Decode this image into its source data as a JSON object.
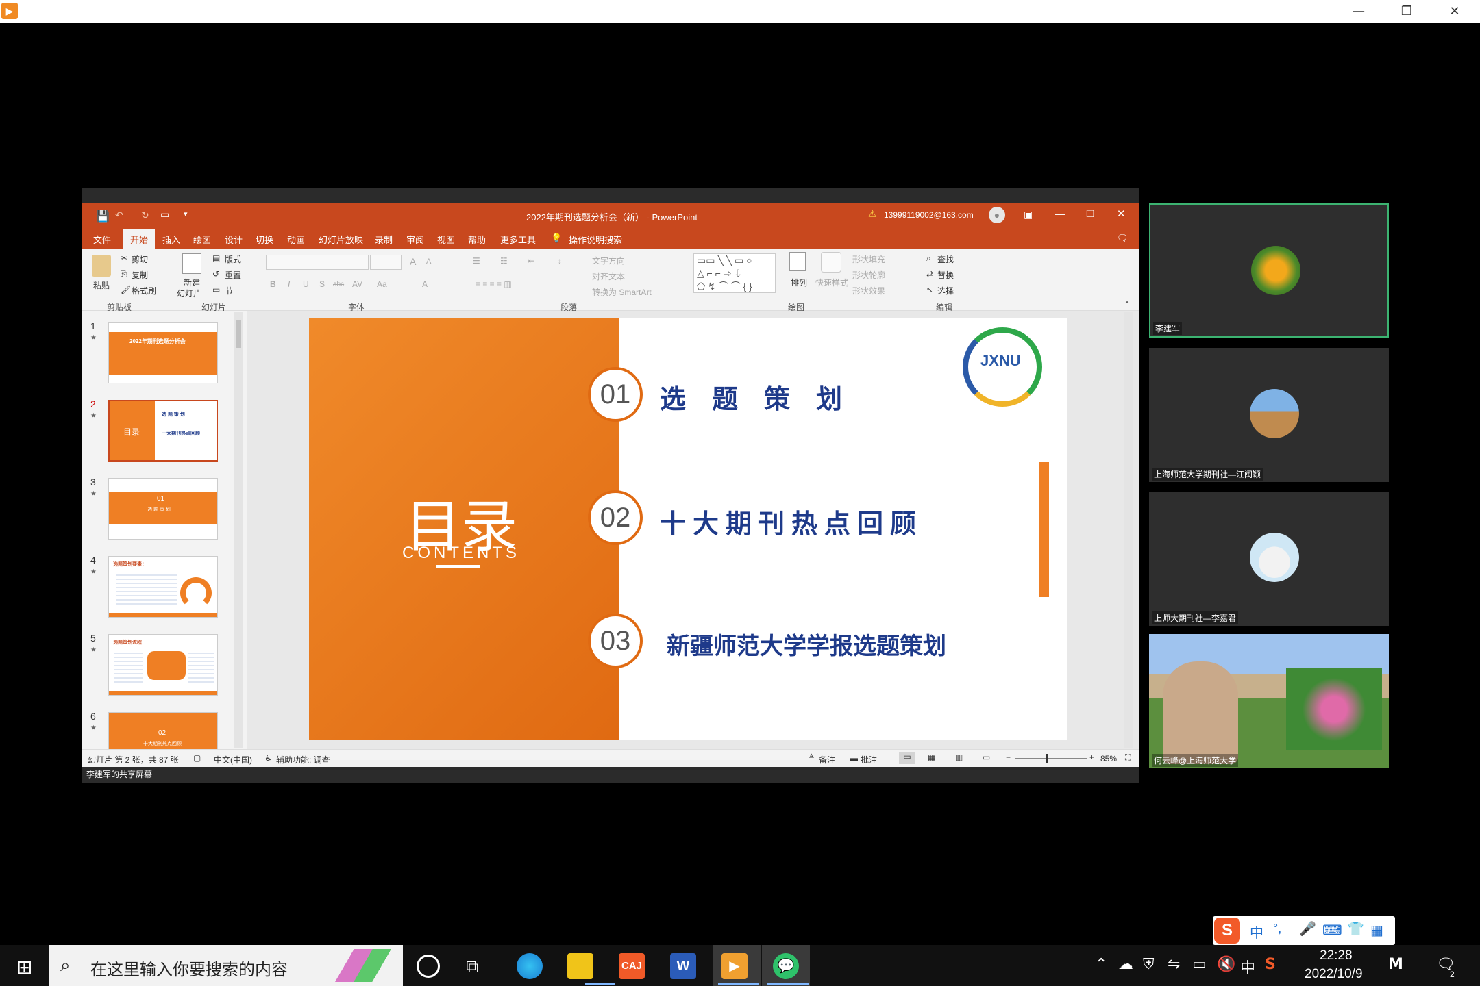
{
  "os_window": {
    "min": "—",
    "restore": "❐",
    "close": "✕"
  },
  "ppt": {
    "title": "2022年期刊选题分析会（新） - PowerPoint",
    "account": "13999119002@163.com",
    "tabs": [
      "文件",
      "开始",
      "插入",
      "绘图",
      "设计",
      "切换",
      "动画",
      "幻灯片放映",
      "录制",
      "审阅",
      "视图",
      "帮助",
      "更多工具",
      "操作说明搜索"
    ],
    "ribbon": {
      "paste": "粘贴",
      "cut": "剪切",
      "copy": "复制",
      "format_painter": "格式刷",
      "clipboard": "剪贴板",
      "new_slide_1": "新建",
      "new_slide_2": "幻灯片",
      "layout": "版式",
      "reset": "重置",
      "section": "节",
      "slides": "幻灯片",
      "font": "字体",
      "text_direction": "文字方向",
      "align_text": "对齐文本",
      "smartart": "转换为 SmartArt",
      "paragraph": "段落",
      "arrange": "排列",
      "quick_styles": "快速样式",
      "shape_fill": "形状填充",
      "shape_outline": "形状轮廓",
      "shape_effects": "形状效果",
      "drawing": "绘图",
      "find": "查找",
      "replace": "替换",
      "select": "选择",
      "editing": "编辑",
      "font_b": "B",
      "font_i": "I",
      "font_u": "U",
      "font_s": "S",
      "font_abc": "abc",
      "font_av": "AV",
      "font_aa": "Aa",
      "font_a": "A",
      "grow": "A",
      "shrink": "A"
    },
    "thumbnails": [
      {
        "num": "1",
        "title": "2022年期刊选题分析会",
        "t2": "",
        "t3": ""
      },
      {
        "num": "2",
        "title": "目录",
        "t2": "选 题 策 划",
        "t3": "十大期刊热点回顾"
      },
      {
        "num": "3",
        "title": "01",
        "t2": "选 题 策 划",
        "t3": ""
      },
      {
        "num": "4",
        "title": "选题策划要素：",
        "t2": "",
        "t3": ""
      },
      {
        "num": "5",
        "title": "选题策划流程",
        "t2": "",
        "t3": ""
      },
      {
        "num": "6",
        "title": "02",
        "t2": "十大期刊热点回顾",
        "t3": ""
      }
    ],
    "slide": {
      "title": "目录",
      "subtitle": "CONTENTS",
      "items": [
        {
          "num": "01",
          "text": "选　题　策　划"
        },
        {
          "num": "02",
          "text": "十大期刊热点回顾"
        },
        {
          "num": "03",
          "text": "新疆师范大学学报选题策划"
        }
      ],
      "logo_text": "JXNU"
    },
    "status": {
      "slide_info": "幻灯片 第 2 张，共 87 张",
      "language": "中文(中国)",
      "accessibility": "辅助功能: 调查",
      "notes": "备注",
      "comments": "批注",
      "zoom": "85%"
    }
  },
  "share_label": "李建军的共享屏幕",
  "participants": [
    {
      "name": "李建军",
      "active": true
    },
    {
      "name": "上海师范大学期刊社—江闽颖",
      "active": false
    },
    {
      "name": "上师大期刊社—李嘉君",
      "active": false
    },
    {
      "name": "何云峰@上海师范大学",
      "active": false
    }
  ],
  "taskbar": {
    "search_placeholder": "在这里输入你要搜索的内容",
    "time": "22:28",
    "date": "2022/10/9",
    "ime_lang": "中",
    "caj": "CAJ",
    "word": "W",
    "notifications": "2"
  },
  "ime_bar": {
    "logo": "S",
    "lang": "中",
    "punct": "°,"
  }
}
